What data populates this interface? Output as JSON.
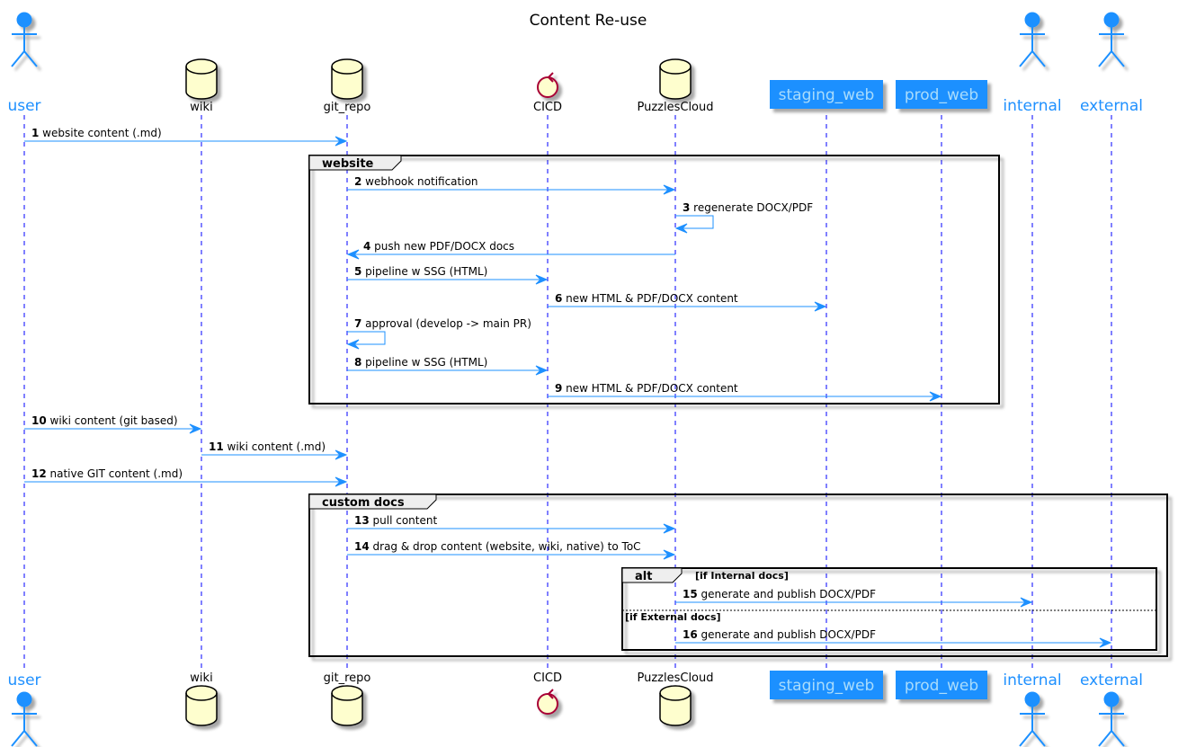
{
  "title": "Content Re-use",
  "colors": {
    "accent": "#1E90FF",
    "lifeline": "#0000FF",
    "database_fill": "#FEFECE",
    "control_stroke": "#A80036",
    "box_text": "#A9DCFC",
    "group_header_fill": "#EEEEEE"
  },
  "participants": [
    {
      "id": "user",
      "label": "user",
      "type": "actor"
    },
    {
      "id": "wiki",
      "label": "wiki",
      "type": "database"
    },
    {
      "id": "git_repo",
      "label": "git_repo",
      "type": "database"
    },
    {
      "id": "CICD",
      "label": "CICD",
      "type": "control"
    },
    {
      "id": "PuzzlesCloud",
      "label": "PuzzlesCloud",
      "type": "database"
    },
    {
      "id": "staging_web",
      "label": "staging_web",
      "type": "participant"
    },
    {
      "id": "prod_web",
      "label": "prod_web",
      "type": "participant"
    },
    {
      "id": "internal",
      "label": "internal",
      "type": "actor"
    },
    {
      "id": "external",
      "label": "external",
      "type": "actor"
    }
  ],
  "messages": [
    {
      "num": "1",
      "from": "user",
      "to": "git_repo",
      "text": "website content (.md)"
    },
    {
      "num": "2",
      "from": "git_repo",
      "to": "PuzzlesCloud",
      "text": "webhook notification"
    },
    {
      "num": "3",
      "from": "PuzzlesCloud",
      "to": "PuzzlesCloud",
      "text": "regenerate DOCX/PDF"
    },
    {
      "num": "4",
      "from": "PuzzlesCloud",
      "to": "git_repo",
      "text": "push new PDF/DOCX docs"
    },
    {
      "num": "5",
      "from": "git_repo",
      "to": "CICD",
      "text": "pipeline w SSG (HTML)"
    },
    {
      "num": "6",
      "from": "CICD",
      "to": "staging_web",
      "text": "new HTML & PDF/DOCX content"
    },
    {
      "num": "7",
      "from": "git_repo",
      "to": "git_repo",
      "text": "approval (develop -> main PR)"
    },
    {
      "num": "8",
      "from": "git_repo",
      "to": "CICD",
      "text": "pipeline w SSG (HTML)"
    },
    {
      "num": "9",
      "from": "CICD",
      "to": "prod_web",
      "text": "new HTML & PDF/DOCX content"
    },
    {
      "num": "10",
      "from": "user",
      "to": "wiki",
      "text": "wiki content (git based)"
    },
    {
      "num": "11",
      "from": "wiki",
      "to": "git_repo",
      "text": "wiki content (.md)"
    },
    {
      "num": "12",
      "from": "user",
      "to": "git_repo",
      "text": "native GIT content (.md)"
    },
    {
      "num": "13",
      "from": "git_repo",
      "to": "PuzzlesCloud",
      "text": "pull content"
    },
    {
      "num": "14",
      "from": "git_repo",
      "to": "PuzzlesCloud",
      "text": "drag & drop content (website, wiki, native) to ToC"
    },
    {
      "num": "15",
      "from": "PuzzlesCloud",
      "to": "internal",
      "text": "generate and publish DOCX/PDF"
    },
    {
      "num": "16",
      "from": "PuzzlesCloud",
      "to": "external",
      "text": "generate and publish DOCX/PDF"
    }
  ],
  "groups": [
    {
      "id": "website",
      "label": "website"
    },
    {
      "id": "custom_docs",
      "label": "custom docs"
    },
    {
      "id": "alt",
      "label": "alt",
      "condition": "[if Internal docs]",
      "else_condition": "[if External docs]"
    }
  ]
}
